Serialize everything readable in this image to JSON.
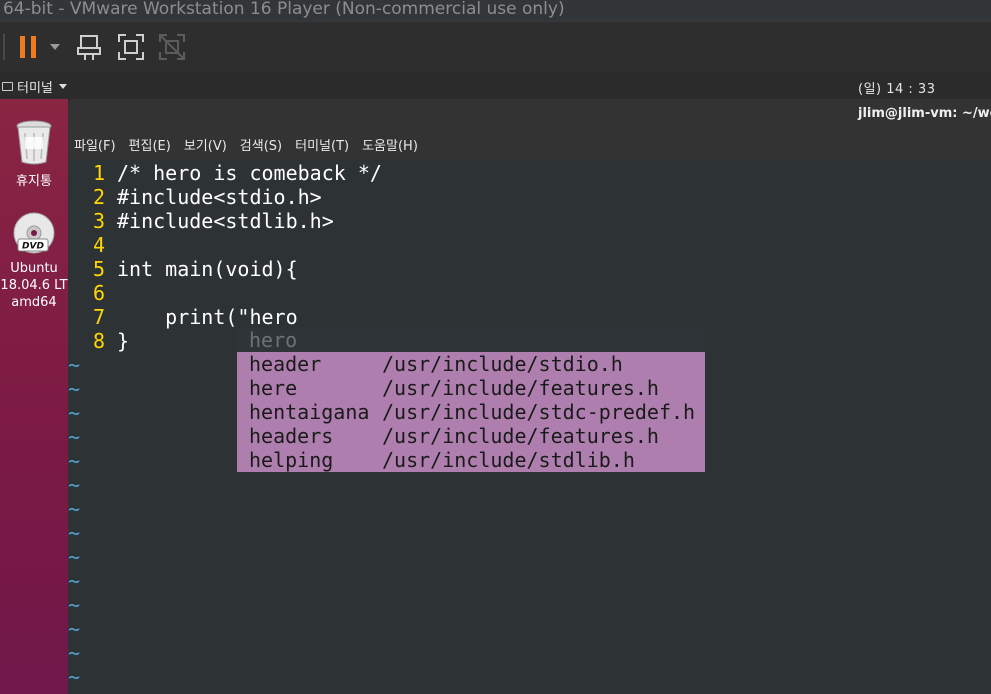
{
  "vm": {
    "title": "64-bit - VMware Workstation 16 Player (Non-commercial use only)",
    "toolbar": {
      "pause_icon": "pause-icon",
      "send_keys_icon": "send-keys-icon",
      "fullscreen_icon": "fullscreen-icon",
      "unity_icon": "unity-icon"
    }
  },
  "panel": {
    "app_label": "터미널",
    "clock": "(일) 14 : 33"
  },
  "dock": {
    "items": [
      {
        "label": "휴지통",
        "icon": "trash-icon"
      },
      {
        "label_lines": [
          "Ubuntu",
          "18.04.6 LT",
          "amd64"
        ],
        "icon": "dvd-icon"
      }
    ]
  },
  "terminal": {
    "title": "jlim@jlim-vm: ~/wo",
    "menu": [
      "파일(F)",
      "편집(E)",
      "보기(V)",
      "검색(S)",
      "터미널(T)",
      "도움말(H)"
    ]
  },
  "editor": {
    "lines": [
      {
        "num": "1",
        "text": "/* hero is comeback */"
      },
      {
        "num": "2",
        "text": "#include<stdio.h>"
      },
      {
        "num": "3",
        "text": "#include<stdlib.h>"
      },
      {
        "num": "4",
        "text": ""
      },
      {
        "num": "5",
        "text": "int main(void){"
      },
      {
        "num": "6",
        "text": ""
      },
      {
        "num": "7",
        "text": "    print(\"hero"
      },
      {
        "num": "8",
        "text": "}"
      }
    ],
    "tilde": "~",
    "completion": {
      "original": "hero",
      "items": [
        {
          "word": "header",
          "source": "/usr/include/stdio.h"
        },
        {
          "word": "here",
          "source": "/usr/include/features.h"
        },
        {
          "word": "hentaigana",
          "source": "/usr/include/stdc-predef.h"
        },
        {
          "word": "headers",
          "source": "/usr/include/features.h"
        },
        {
          "word": "helping",
          "source": "/usr/include/stdlib.h"
        }
      ]
    }
  },
  "colors": {
    "line_number": "#ffd700",
    "tilde": "#4fa3d4",
    "popup_bg": "#ae7fae",
    "pause_accent": "#f07b1f",
    "dock_bg": "#7a1945"
  }
}
